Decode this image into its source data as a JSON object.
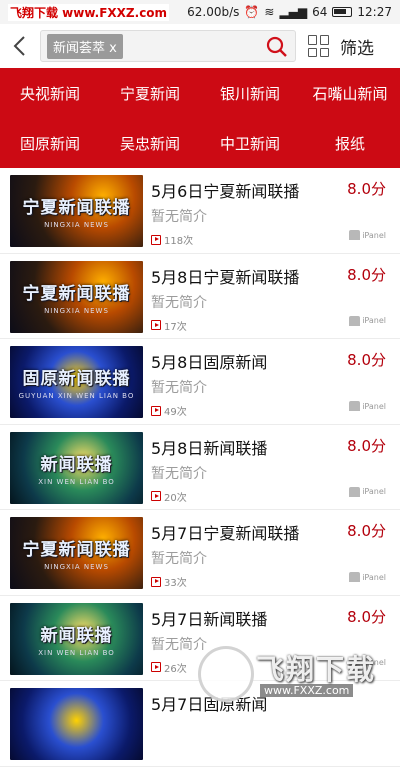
{
  "status_bar": {
    "watermark": "飞翔下载 www.FXXZ.com",
    "network_speed": "62.00b/s",
    "signal": "64",
    "time": "12:27"
  },
  "header": {
    "search_tag": "新闻荟萃 x",
    "filter_label": "筛选"
  },
  "categories": [
    "央视新闻",
    "宁夏新闻",
    "银川新闻",
    "石嘴山新闻",
    "固原新闻",
    "吴忠新闻",
    "中卫新闻",
    "报纸"
  ],
  "items": [
    {
      "title": "5月6日宁夏新闻联播",
      "rating": "8.0分",
      "intro": "暂无简介",
      "views": "118次",
      "source": "iPanel",
      "thumb_text": "宁夏新闻联播",
      "thumb_sub": "NINGXIA NEWS",
      "thumb_style": "ningxia"
    },
    {
      "title": "5月8日宁夏新闻联播",
      "rating": "8.0分",
      "intro": "暂无简介",
      "views": "17次",
      "source": "iPanel",
      "thumb_text": "宁夏新闻联播",
      "thumb_sub": "NINGXIA NEWS",
      "thumb_style": "ningxia"
    },
    {
      "title": "5月8日固原新闻",
      "rating": "8.0分",
      "intro": "暂无简介",
      "views": "49次",
      "source": "iPanel",
      "thumb_text": "固原新闻联播",
      "thumb_sub": "GUYUAN XIN WEN LIAN BO",
      "thumb_style": "guyuan"
    },
    {
      "title": "5月8日新闻联播",
      "rating": "8.0分",
      "intro": "暂无简介",
      "views": "20次",
      "source": "iPanel",
      "thumb_text": "新闻联播",
      "thumb_sub": "XIN WEN LIAN BO",
      "thumb_style": "cctv"
    },
    {
      "title": "5月7日宁夏新闻联播",
      "rating": "8.0分",
      "intro": "暂无简介",
      "views": "33次",
      "source": "iPanel",
      "thumb_text": "宁夏新闻联播",
      "thumb_sub": "NINGXIA NEWS",
      "thumb_style": "ningxia"
    },
    {
      "title": "5月7日新闻联播",
      "rating": "8.0分",
      "intro": "暂无简介",
      "views": "26次",
      "source": "iPanel",
      "thumb_text": "新闻联播",
      "thumb_sub": "XIN WEN LIAN BO",
      "thumb_style": "cctv"
    },
    {
      "title": "5月7日固原新闻",
      "rating": "",
      "intro": "",
      "views": "",
      "source": "",
      "thumb_text": "",
      "thumb_sub": "",
      "thumb_style": "guyuan"
    }
  ],
  "watermark_bottom": {
    "brand": "飞翔下载",
    "url": "www.FXXZ.com"
  },
  "colors": {
    "accent_red": "#cc0a14",
    "rating_red": "#b3000c"
  },
  "icons": [
    "back-arrow-icon",
    "search-icon",
    "grid-view-icon",
    "play-count-icon",
    "ipanel-source-icon"
  ]
}
